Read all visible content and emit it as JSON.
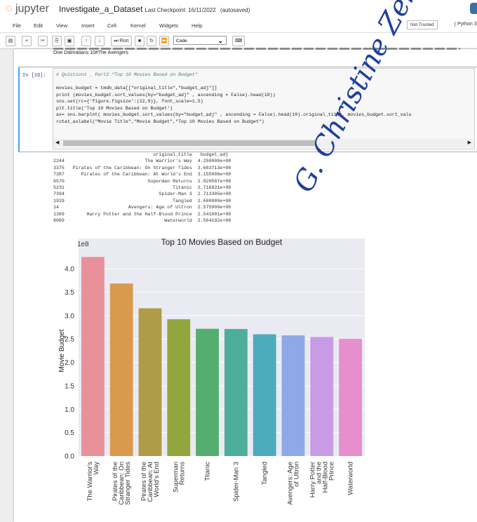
{
  "header": {
    "logo": "jupyter",
    "notebook_title": "Investigate_a_Dataset",
    "checkpoint": "Last Checkpoint: 16/11/2022",
    "autosave": "(autosaved)"
  },
  "menu": [
    "File",
    "Edit",
    "View",
    "Insert",
    "Cell",
    "Kernel",
    "Widgets",
    "Help"
  ],
  "trust": "Not Trusted",
  "kernel": "Python 3",
  "toolbar": {
    "run": "Run",
    "cell_type": "Code"
  },
  "prev_output": "One Dalmatians 10#The Avengers",
  "cell": {
    "prompt": "In [10]:",
    "code": [
      "# Quistion1 _ Part2 \"Top 10 Movies Based on Budget\"",
      "",
      "movies_budget = tmdb_data[[\"original_title\",\"budget_adj\"]]",
      "print (movies_budget.sort_values(by=\"budget_adj\" , ascending = False).head(10))",
      "sns.set(rc={'figure.figsize':(12,9)}, font_scale=1.5)",
      "plt.title('Top 10 Movies Based on Budget')",
      "ax= sns.barplot( movies_budget.sort_values(by=\"budget_adj\" , ascending = False).head(10).original_title, movies_budget.sort_valu",
      "rotat_axlabel(\"Movie Title\",\"Movie Budget\",\"Top 10 Movies Based on Budget\")"
    ]
  },
  "output": {
    "headers": [
      "original_title",
      "budget_adj"
    ],
    "rows": [
      {
        "idx": "2244",
        "title": "The Warrior's Way",
        "budget": "4.250000e+08"
      },
      {
        "idx": "3375",
        "title": "Pirates of the Caribbean: On Stranger Tides",
        "budget": "3.683713e+08"
      },
      {
        "idx": "7387",
        "title": "Pirates of the Caribbean: At World's End",
        "budget": "3.155006e+08"
      },
      {
        "idx": "6570",
        "title": "Superman Returns",
        "budget": "2.920507e+08"
      },
      {
        "idx": "5231",
        "title": "Titanic",
        "budget": "2.716921e+08"
      },
      {
        "idx": "7394",
        "title": "Spider-Man 3",
        "budget": "2.713305e+08"
      },
      {
        "idx": "1929",
        "title": "Tangled",
        "budget": "2.600000e+08"
      },
      {
        "idx": "14",
        "title": "Avengers: Age of Ultron",
        "budget": "2.575999e+08"
      },
      {
        "idx": "1389",
        "title": "Harry Potter and the Half-Blood Prince",
        "budget": "2.541001e+08"
      },
      {
        "idx": "8089",
        "title": "Waterworld",
        "budget": "2.504192e+08"
      }
    ]
  },
  "signature": "G. Christine Zekrian",
  "chart_data": {
    "type": "bar",
    "title": "Top 10 Movies Based on Budget",
    "xlabel": "",
    "ylabel": "Movie Budget",
    "offset_label": "1e8",
    "categories": [
      "The Warrior's Way",
      "Pirates of the Caribbean: On Stranger Tides",
      "Pirates of the Caribbean: At World's End",
      "Superman Returns",
      "Titanic",
      "Spider-Man 3",
      "Tangled",
      "Avengers: Age of Ultron",
      "Harry Potter and the Half-Blood Prince",
      "Waterworld"
    ],
    "values": [
      4.25,
      3.683713,
      3.155006,
      2.920507,
      2.716921,
      2.713305,
      2.6,
      2.575999,
      2.541001,
      2.504192
    ],
    "yticks": [
      "0.0",
      "0.5",
      "1.0",
      "1.5",
      "2.0",
      "2.5",
      "3.0",
      "3.5",
      "4.0"
    ],
    "ylim": [
      0,
      4.4
    ],
    "grid": true,
    "colors": [
      "#e8919b",
      "#d99a4e",
      "#b09b48",
      "#93a53e",
      "#55ae6f",
      "#4fad9c",
      "#4eaabd",
      "#8ea9e6",
      "#c79be6",
      "#e68fcd"
    ]
  }
}
